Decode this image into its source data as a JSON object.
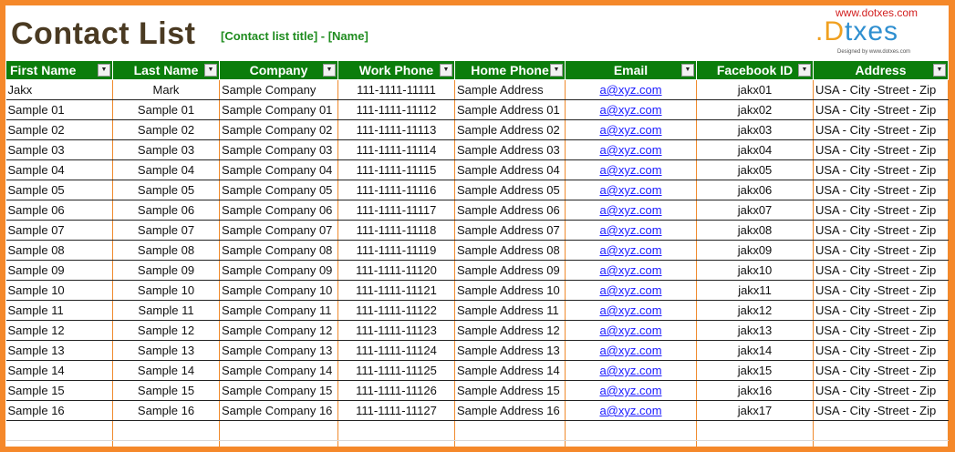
{
  "header": {
    "title": "Contact List",
    "subtitle": "[Contact list title] - [Name]",
    "site_url": "www.dotxes.com",
    "logo_text_a": ".D",
    "logo_text_b": "txes",
    "logo_tagline": "Designed by www.dotxes.com"
  },
  "colors": {
    "header_bg": "#0b7d0b",
    "border": "#f5882a",
    "title": "#4a3a22",
    "link": "#1a1aff"
  },
  "table": {
    "columns": [
      "First Name",
      "Last Name",
      "Company",
      "Work Phone",
      "Home Phone",
      "Email",
      "Facebook ID",
      "Address"
    ],
    "rows": [
      [
        "Jakx",
        "Mark",
        "Sample Company",
        "111-1111-11111",
        "Sample Address",
        "a@xyz.com",
        "jakx01",
        "USA - City -Street - Zip"
      ],
      [
        "Sample 01",
        "Sample 01",
        "Sample Company 01",
        "111-1111-11112",
        "Sample Address 01",
        "a@xyz.com",
        "jakx02",
        "USA - City -Street - Zip"
      ],
      [
        "Sample 02",
        "Sample 02",
        "Sample Company 02",
        "111-1111-11113",
        "Sample Address 02",
        "a@xyz.com",
        "jakx03",
        "USA - City -Street - Zip"
      ],
      [
        "Sample 03",
        "Sample 03",
        "Sample Company 03",
        "111-1111-11114",
        "Sample Address 03",
        "a@xyz.com",
        "jakx04",
        "USA - City -Street - Zip"
      ],
      [
        "Sample 04",
        "Sample 04",
        "Sample Company 04",
        "111-1111-11115",
        "Sample Address 04",
        "a@xyz.com",
        "jakx05",
        "USA - City -Street - Zip"
      ],
      [
        "Sample 05",
        "Sample 05",
        "Sample Company 05",
        "111-1111-11116",
        "Sample Address 05",
        "a@xyz.com",
        "jakx06",
        "USA - City -Street - Zip"
      ],
      [
        "Sample 06",
        "Sample 06",
        "Sample Company 06",
        "111-1111-11117",
        "Sample Address 06",
        "a@xyz.com",
        "jakx07",
        "USA - City -Street - Zip"
      ],
      [
        "Sample 07",
        "Sample 07",
        "Sample Company 07",
        "111-1111-11118",
        "Sample Address 07",
        "a@xyz.com",
        "jakx08",
        "USA - City -Street - Zip"
      ],
      [
        "Sample 08",
        "Sample 08",
        "Sample Company 08",
        "111-1111-11119",
        "Sample Address 08",
        "a@xyz.com",
        "jakx09",
        "USA - City -Street - Zip"
      ],
      [
        "Sample 09",
        "Sample 09",
        "Sample Company 09",
        "111-1111-11120",
        "Sample Address 09",
        "a@xyz.com",
        "jakx10",
        "USA - City -Street - Zip"
      ],
      [
        "Sample 10",
        "Sample 10",
        "Sample Company 10",
        "111-1111-11121",
        "Sample Address 10",
        "a@xyz.com",
        "jakx11",
        "USA - City -Street - Zip"
      ],
      [
        "Sample 11",
        "Sample 11",
        "Sample Company 11",
        "111-1111-11122",
        "Sample Address 11",
        "a@xyz.com",
        "jakx12",
        "USA - City -Street - Zip"
      ],
      [
        "Sample 12",
        "Sample 12",
        "Sample Company 12",
        "111-1111-11123",
        "Sample Address 12",
        "a@xyz.com",
        "jakx13",
        "USA - City -Street - Zip"
      ],
      [
        "Sample 13",
        "Sample 13",
        "Sample Company 13",
        "111-1111-11124",
        "Sample Address 13",
        "a@xyz.com",
        "jakx14",
        "USA - City -Street - Zip"
      ],
      [
        "Sample 14",
        "Sample 14",
        "Sample Company 14",
        "111-1111-11125",
        "Sample Address 14",
        "a@xyz.com",
        "jakx15",
        "USA - City -Street - Zip"
      ],
      [
        "Sample 15",
        "Sample 15",
        "Sample Company 15",
        "111-1111-11126",
        "Sample Address 15",
        "a@xyz.com",
        "jakx16",
        "USA - City -Street - Zip"
      ],
      [
        "Sample 16",
        "Sample 16",
        "Sample Company 16",
        "111-1111-11127",
        "Sample Address 16",
        "a@xyz.com",
        "jakx17",
        "USA - City -Street - Zip"
      ]
    ]
  }
}
